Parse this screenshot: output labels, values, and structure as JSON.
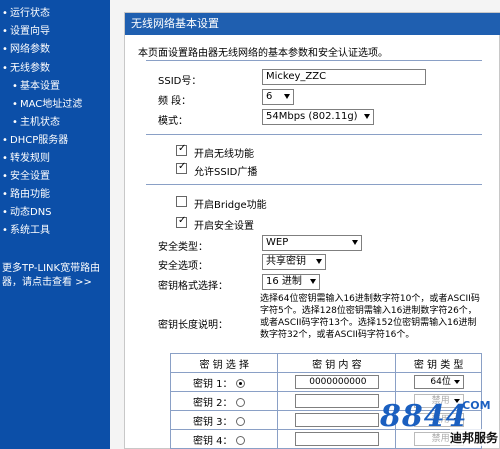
{
  "sidebar": {
    "items": [
      {
        "label": "运行状态"
      },
      {
        "label": "设置向导"
      },
      {
        "label": "网络参数"
      },
      {
        "label": "无线参数"
      },
      {
        "label": "基本设置"
      },
      {
        "label": "MAC地址过滤"
      },
      {
        "label": "主机状态"
      },
      {
        "label": "DHCP服务器"
      },
      {
        "label": "转发规则"
      },
      {
        "label": "安全设置"
      },
      {
        "label": "路由功能"
      },
      {
        "label": "动态DNS"
      },
      {
        "label": "系统工具"
      }
    ],
    "more_line1": "更多TP-LINK宽带路由",
    "more_line2": "器，请点击查看 >>"
  },
  "panel": {
    "title": "无线网络基本设置",
    "description": "本页面设置路由器无线网络的基本参数和安全认证选项。"
  },
  "form": {
    "ssid_label": "SSID号：",
    "ssid_value": "Mickey_ZZC",
    "channel_label": "频 段：",
    "channel_value": "6",
    "mode_label": "模式：",
    "mode_value": "54Mbps (802.11g)",
    "enable_wireless_label": "开启无线功能",
    "enable_wireless": true,
    "ssid_broadcast_label": "允许SSID广播",
    "ssid_broadcast": true,
    "bridge_label": "开启Bridge功能",
    "bridge": false,
    "security_label": "开启安全设置",
    "security": true,
    "security_type_label": "安全类型：",
    "security_type_value": "WEP",
    "security_option_label": "安全选项：",
    "security_option_value": "共享密钥",
    "key_format_label": "密钥格式选择：",
    "key_format_value": "16 进制",
    "key_length_label": "密钥长度说明：",
    "key_length_help": "选择64位密钥需输入16进制数字符10个，或者ASCII码字符5个。选择128位密钥需输入16进制数字符26个，或者ASCII码字符13个。选择152位密钥需输入16进制数字符32个，或者ASCII码字符16个。"
  },
  "key_table": {
    "headers": [
      "密 钥 选 择",
      "密 钥 内 容",
      "密 钥 类 型"
    ],
    "rows": [
      {
        "label": "密钥 1：",
        "selected": true,
        "value": "0000000000",
        "type": "64位"
      },
      {
        "label": "密钥 2：",
        "selected": false,
        "value": "",
        "type": "禁用"
      },
      {
        "label": "密钥 3：",
        "selected": false,
        "value": "",
        "type": "禁用"
      },
      {
        "label": "密钥 4：",
        "selected": false,
        "value": "",
        "type": "禁用"
      }
    ]
  },
  "watermark": {
    "number": "8844",
    "domain": ".COM",
    "caption": "迪邦服务"
  },
  "colors": {
    "sidebar_bg": "#0c4fa8",
    "panel_header_bg": "#1f5fb0",
    "watermark_blue": "#1a5fc0"
  }
}
